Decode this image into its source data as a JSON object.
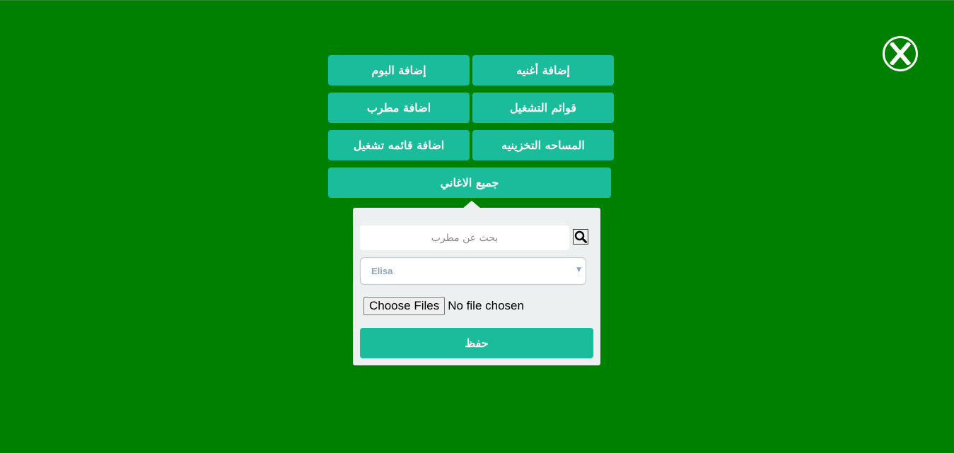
{
  "close": {
    "icon": "close-icon"
  },
  "menu": {
    "add_song": "إضافة أغنيه",
    "add_album": "إضافة البوم",
    "playlists": "قوائم التشغيل",
    "add_artist": "اضافة مطرب",
    "storage": "المساحه التخزينيه",
    "add_playlist": "اضافة قائمه تشغيل",
    "all_songs": "جميع الاغاني"
  },
  "form": {
    "search_placeholder": "بحث عن مطرب",
    "search_icon": "search-icon",
    "artist_selected": "Elisa",
    "file_button": "Choose Files",
    "file_status": "No file chosen",
    "save_label": "حفظ"
  },
  "colors": {
    "background": "#008000",
    "accent": "#1abc9c",
    "panel": "#ecf0f1"
  }
}
